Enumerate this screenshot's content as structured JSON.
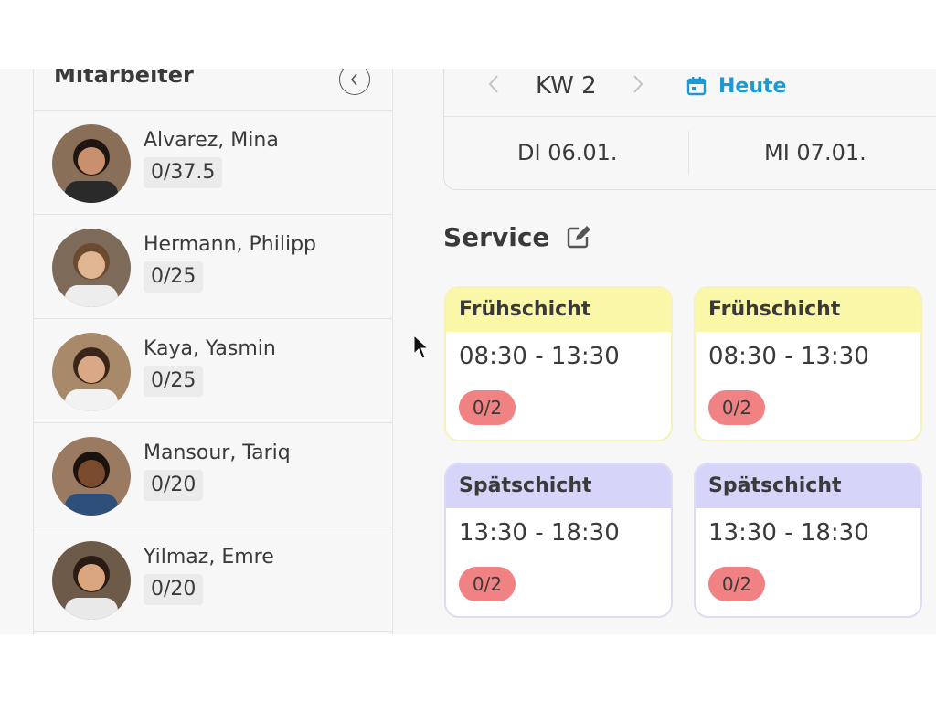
{
  "sidebar": {
    "title": "Mitarbeiter",
    "collapse_icon": "chevron-left-circle-icon",
    "employees": [
      {
        "name": "Alvarez, Mina",
        "hours": "0/37.5",
        "skin": "#c9906e",
        "hair": "#1f1612",
        "shirt": "#2a2a2a"
      },
      {
        "name": "Hermann, Philipp",
        "hours": "0/25",
        "skin": "#e0b592",
        "hair": "#6b4a30",
        "shirt": "#ededed"
      },
      {
        "name": "Kaya, Yasmin",
        "hours": "0/25",
        "skin": "#d8a887",
        "hair": "#3b2418",
        "shirt": "#f2f2f2"
      },
      {
        "name": "Mansour, Tariq",
        "hours": "0/20",
        "skin": "#7a4a2e",
        "hair": "#1a120d",
        "shirt": "#2e4f7a"
      },
      {
        "name": "Yilmaz, Emre",
        "hours": "0/20",
        "skin": "#d9a680",
        "hair": "#2a1c14",
        "shirt": "#e9e9e9"
      }
    ]
  },
  "week": {
    "label": "KW 2",
    "today_label": "Heute",
    "today_icon": "calendar-icon",
    "days": [
      "DI 06.01.",
      "MI 07.01."
    ]
  },
  "section": {
    "title": "Service",
    "edit_icon": "edit-icon"
  },
  "shifts": [
    {
      "name": "Frühschicht",
      "time": "08:30 - 13:30",
      "staffing": "0/2",
      "kind": "early"
    },
    {
      "name": "Frühschicht",
      "time": "08:30 - 13:30",
      "staffing": "0/2",
      "kind": "early"
    },
    {
      "name": "Spätschicht",
      "time": "13:30 - 18:30",
      "staffing": "0/2",
      "kind": "late"
    },
    {
      "name": "Spätschicht",
      "time": "13:30 - 18:30",
      "staffing": "0/2",
      "kind": "late"
    }
  ],
  "colors": {
    "accent": "#1b9ad6",
    "early_header": "#fbf7a9",
    "late_header": "#d6d4f8",
    "badge": "#f08284"
  }
}
